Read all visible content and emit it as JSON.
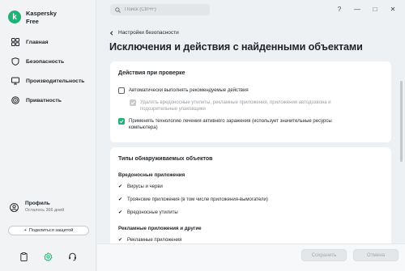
{
  "app": {
    "brand_line1": "Kaspersky",
    "brand_line2": "Free",
    "accent": "#1fb176"
  },
  "sidebar": {
    "items": [
      {
        "label": "Главная",
        "icon": "grid-icon"
      },
      {
        "label": "Безопасность",
        "icon": "shield-icon"
      },
      {
        "label": "Производительность",
        "icon": "monitor-icon"
      },
      {
        "label": "Приватность",
        "icon": "fingerprint-icon"
      }
    ],
    "profile_name": "Профиль",
    "profile_sub": "Осталось 366 дней",
    "share_label": "Поделиться защитой",
    "bottom_icons": [
      "clipboard-icon",
      "settings-icon",
      "support-headset-icon"
    ]
  },
  "topbar": {
    "search_placeholder": "Поиск (Ctrl+F)",
    "help": "?",
    "minimize": "—",
    "maximize": "□",
    "close": "✕"
  },
  "page": {
    "breadcrumb": "Настройки безопасности",
    "title": "Исключения и действия с найденными объектами"
  },
  "card1": {
    "heading": "Действия при проверке",
    "opt1": "Автоматически выполнять рекомендуемые действия",
    "opt1_checked": false,
    "opt2_line1": "Удалять вредоносные утилиты, рекламные приложения, приложения автодозвона и",
    "opt2_line2": "подозрительные упаковщики",
    "opt2_checked": true,
    "opt2_disabled": true,
    "opt3_line1": "Применять технологию лечения активного заражения (использует значительные ресурсы",
    "opt3_line2": "компьютера)",
    "opt3_checked": true
  },
  "card2": {
    "heading": "Типы обнаруживаемых объектов",
    "group1": "Вредоносные приложения",
    "group1_items": [
      "Вирусы и черви",
      "Троянские приложения (в том числе приложения-вымогатели)",
      "Вредоносные утилиты"
    ],
    "group2": "Рекламные приложения и другие",
    "group2_items": [
      "Рекламные приложения"
    ]
  },
  "footer": {
    "save": "Сохранить",
    "cancel": "Отмена"
  }
}
